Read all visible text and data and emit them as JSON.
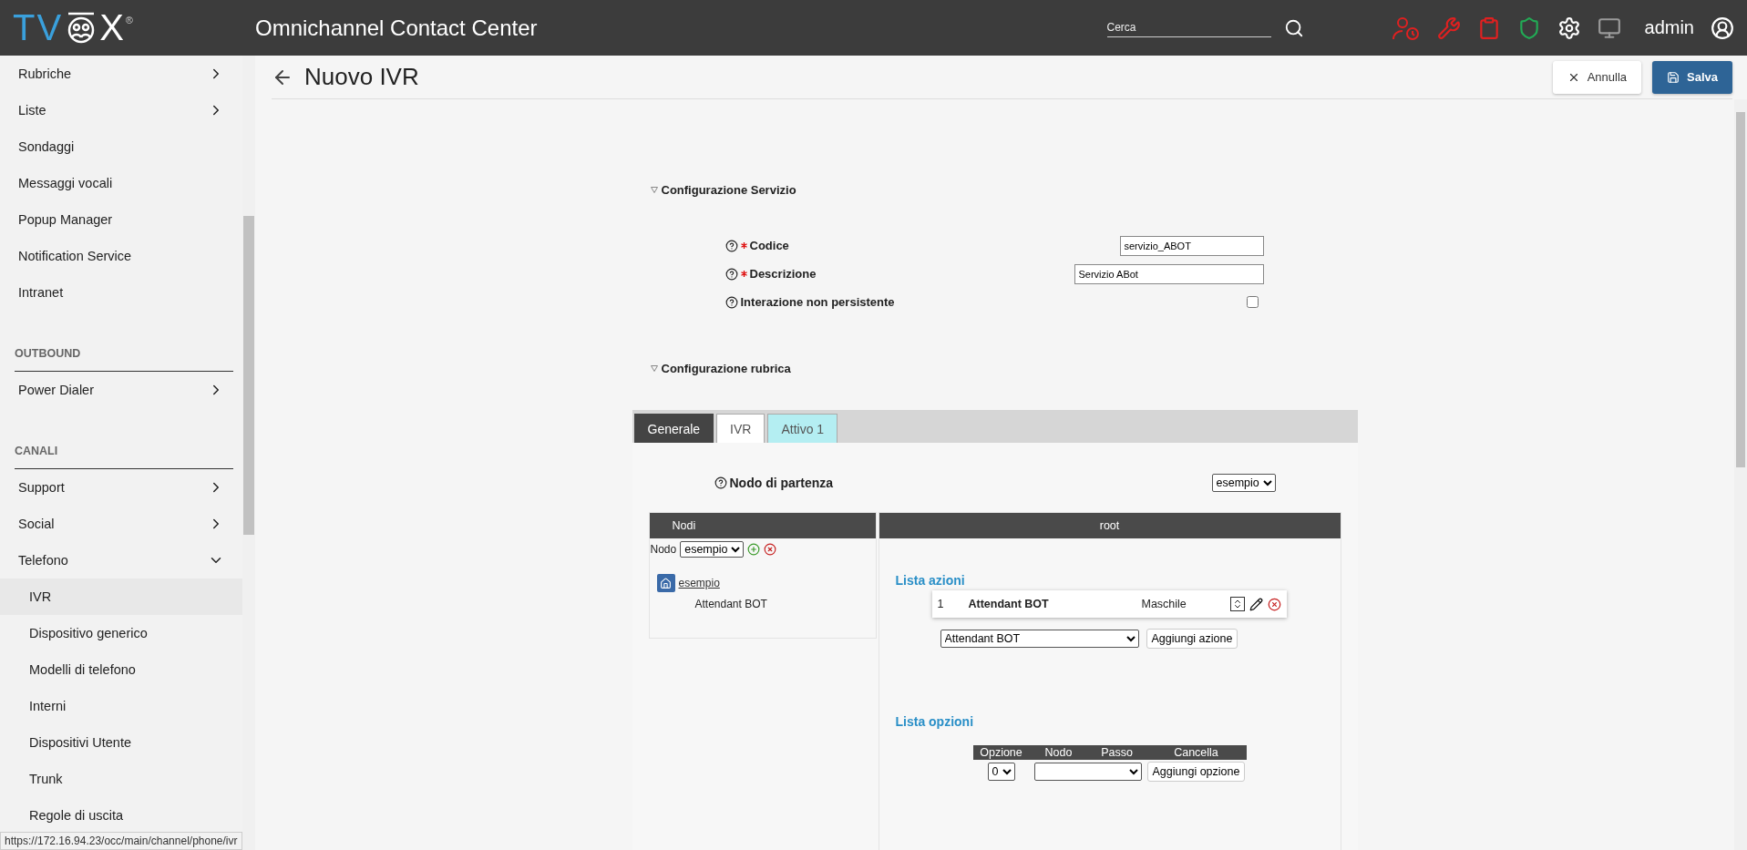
{
  "topbar": {
    "logo": {
      "before": "TV",
      "after": "X",
      "mark": "®"
    },
    "title": "Omnichannel Contact Center",
    "search": {
      "placeholder": "Cerca"
    },
    "user": "admin"
  },
  "sidebar": {
    "items": [
      {
        "kind": "link",
        "label": "Rubriche",
        "expanded": false
      },
      {
        "kind": "link",
        "label": "Liste",
        "expanded": false
      },
      {
        "kind": "link",
        "label": "Sondaggi"
      },
      {
        "kind": "link",
        "label": "Messaggi vocali"
      },
      {
        "kind": "link",
        "label": "Popup Manager"
      },
      {
        "kind": "link",
        "label": "Notification Service"
      },
      {
        "kind": "link",
        "label": "Intranet"
      },
      {
        "kind": "header",
        "label": "OUTBOUND"
      },
      {
        "kind": "link",
        "label": "Power Dialer",
        "expanded": false
      },
      {
        "kind": "header",
        "label": "CANALI"
      },
      {
        "kind": "link",
        "label": "Support",
        "expanded": false
      },
      {
        "kind": "link",
        "label": "Social",
        "expanded": false
      },
      {
        "kind": "link",
        "label": "Telefono",
        "expanded": true,
        "children": [
          {
            "label": "IVR",
            "selected": true
          },
          {
            "label": "Dispositivo generico",
            "selected": false
          },
          {
            "label": "Modelli di telefono",
            "selected": false
          },
          {
            "label": "Interni",
            "selected": false
          },
          {
            "label": "Dispositivi Utente",
            "selected": false
          },
          {
            "label": "Trunk",
            "selected": false
          },
          {
            "label": "Regole di uscita",
            "selected": false
          }
        ]
      }
    ]
  },
  "header": {
    "title": "Nuovo IVR",
    "buttons": [
      {
        "kind": "cancel",
        "label": "Annulla"
      },
      {
        "kind": "save",
        "label": "Salva"
      }
    ]
  },
  "sections": [
    {
      "title": "Configurazione Servizio",
      "fields": [
        {
          "kind": "text",
          "label": "Codice",
          "required": true,
          "value": "servizio_ABOT",
          "wide": false
        },
        {
          "kind": "text",
          "label": "Descrizione",
          "required": true,
          "value": "Servizio ABot",
          "wide": true
        },
        {
          "kind": "checkbox",
          "label": "Interazione non persistente",
          "required": false,
          "checked": false
        }
      ]
    },
    {
      "title": "Configurazione rubrica"
    }
  ],
  "tabs": [
    {
      "label": "Generale",
      "kind": "dark",
      "selected": false
    },
    {
      "label": "IVR",
      "kind": "tab",
      "selected": false
    },
    {
      "label": "Attivo 1",
      "kind": "tab",
      "selected": true
    }
  ],
  "start_node": {
    "label": "Nodo di partenza",
    "value": "esempio"
  },
  "nodes_panel": {
    "header": "Nodi",
    "select_label": "Nodo",
    "select_value": "esempio",
    "tree": [
      {
        "label": "esempio",
        "children": [
          {
            "label": "Attendant BOT"
          }
        ]
      }
    ]
  },
  "root_panel": {
    "header": "root",
    "actions_title": "Lista azioni",
    "actions": [
      {
        "index": "1",
        "name": "Attendant BOT",
        "voice": "Maschile"
      }
    ],
    "action_select": "Attendant BOT",
    "add_action": "Aggiungi azione",
    "options_title": "Lista opzioni",
    "option_columns": [
      "Opzione",
      "Nodo",
      "Passo",
      "Cancella"
    ],
    "option_select": "0",
    "add_option": "Aggiungi opzione"
  },
  "status_link": "https://172.16.94.23/occ/main/channel/phone/ivr"
}
